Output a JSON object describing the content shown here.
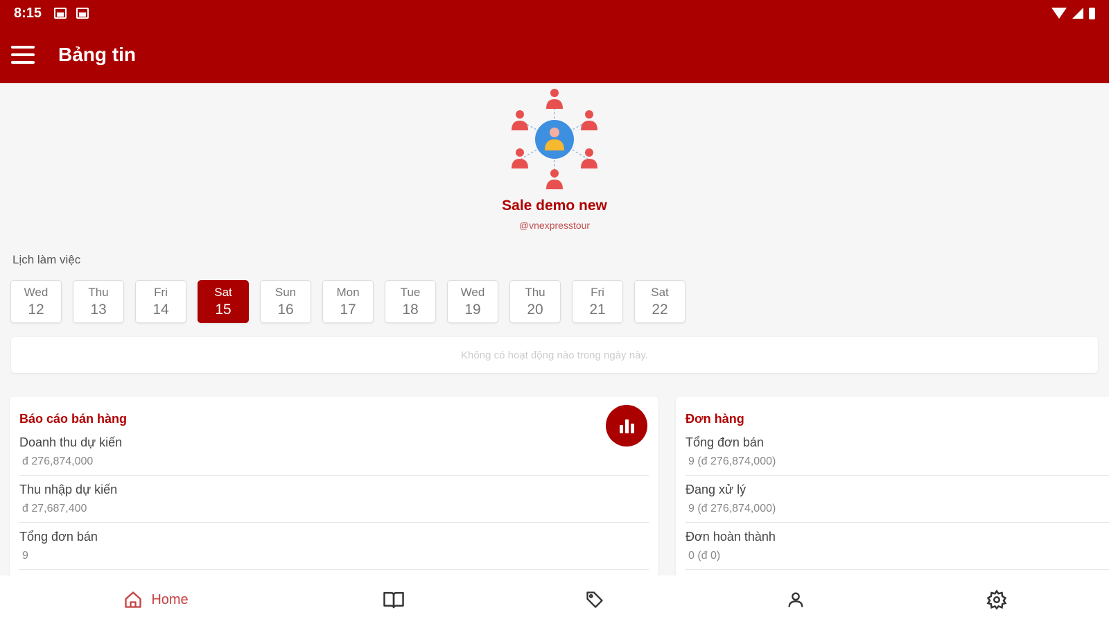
{
  "status_bar": {
    "time": "8:15"
  },
  "app_bar": {
    "title": "Bảng tin"
  },
  "profile": {
    "name": "Sale demo new",
    "handle": "@vnexpresstour"
  },
  "schedule": {
    "label": "Lịch làm việc",
    "days": [
      {
        "name": "Wed",
        "num": "12"
      },
      {
        "name": "Thu",
        "num": "13"
      },
      {
        "name": "Fri",
        "num": "14"
      },
      {
        "name": "Sat",
        "num": "15"
      },
      {
        "name": "Sun",
        "num": "16"
      },
      {
        "name": "Mon",
        "num": "17"
      },
      {
        "name": "Tue",
        "num": "18"
      },
      {
        "name": "Wed",
        "num": "19"
      },
      {
        "name": "Thu",
        "num": "20"
      },
      {
        "name": "Fri",
        "num": "21"
      },
      {
        "name": "Sat",
        "num": "22"
      }
    ],
    "selected_index": 3,
    "empty_text": "Không có hoạt động nào trong ngày này."
  },
  "sales_report": {
    "title": "Báo cáo bán hàng",
    "items": [
      {
        "label": "Doanh thu dự kiến",
        "value": "đ 276,874,000"
      },
      {
        "label": "Thu nhập dự kiến",
        "value": "đ 27,687,400"
      },
      {
        "label": "Tổng đơn bán",
        "value": "9"
      }
    ]
  },
  "orders": {
    "title": "Đơn hàng",
    "items": [
      {
        "label": "Tổng đơn bán",
        "value": "9 (đ 276,874,000)"
      },
      {
        "label": "Đang xử lý",
        "value": "9 (đ 276,874,000)"
      },
      {
        "label": "Đơn hoàn thành",
        "value": "0 (đ 0)"
      }
    ]
  },
  "bottom_nav": {
    "home_label": "Home"
  },
  "colors": {
    "primary": "#ab0000",
    "accent_text": "#b00000"
  }
}
